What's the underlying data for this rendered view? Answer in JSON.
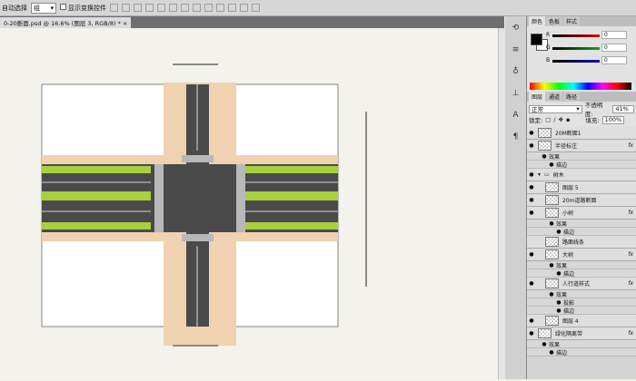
{
  "toolbar": {
    "auto_select_label": "自动选择",
    "auto_select_value": "组",
    "show_transform_label": "显示变换控件"
  },
  "document_tab": {
    "title": "0-20断面.psd @ 16.6% (图层 3, RGB/8) *",
    "close": "×"
  },
  "color_panel": {
    "tabs": [
      "颜色",
      "色板",
      "样式"
    ],
    "channels": [
      {
        "label": "R",
        "value": "0",
        "color": "#d01010"
      },
      {
        "label": "G",
        "value": "0",
        "color": "#20a020"
      },
      {
        "label": "B",
        "value": "0",
        "color": "#1010c0"
      }
    ],
    "foreground": "#000000",
    "background": "#ffffff"
  },
  "layers_panel": {
    "tabs": [
      "图层",
      "通道",
      "路径"
    ],
    "blend_mode": "正常",
    "opacity_label": "不透明度:",
    "opacity": "41%",
    "lock_label": "锁定:",
    "fill_label": "填充:",
    "fill": "100%",
    "items": [
      {
        "type": "layer",
        "name": "20M断面1",
        "fx": false,
        "indent": 0
      },
      {
        "type": "layer",
        "name": "半径标注",
        "fx": true,
        "indent": 0
      },
      {
        "type": "sub",
        "name": "效果",
        "indent": 1
      },
      {
        "type": "sub",
        "name": "描边",
        "indent": 2
      },
      {
        "type": "group",
        "name": "树木",
        "indent": 0
      },
      {
        "type": "layer",
        "name": "图层 5",
        "fx": false,
        "indent": 1
      },
      {
        "type": "layer",
        "name": "20m道路断面",
        "fx": false,
        "indent": 1
      },
      {
        "type": "layer",
        "name": "小树",
        "fx": true,
        "indent": 1
      },
      {
        "type": "sub",
        "name": "效果",
        "indent": 2
      },
      {
        "type": "sub",
        "name": "描边",
        "indent": 3
      },
      {
        "type": "layer",
        "name": "路面线条",
        "fx": false,
        "indent": 1,
        "hidden": true
      },
      {
        "type": "layer",
        "name": "大树",
        "fx": true,
        "indent": 1
      },
      {
        "type": "sub",
        "name": "效果",
        "indent": 2
      },
      {
        "type": "sub",
        "name": "描边",
        "indent": 3
      },
      {
        "type": "layer",
        "name": "人行道样式",
        "fx": true,
        "indent": 1
      },
      {
        "type": "sub",
        "name": "效果",
        "indent": 2
      },
      {
        "type": "sub",
        "name": "投影",
        "indent": 3
      },
      {
        "type": "sub",
        "name": "描边",
        "indent": 3
      },
      {
        "type": "layer",
        "name": "图层 4",
        "fx": false,
        "indent": 1
      },
      {
        "type": "layer",
        "name": "绿化隔离带",
        "fx": true,
        "indent": 0
      },
      {
        "type": "sub",
        "name": "效果",
        "indent": 1
      },
      {
        "type": "sub",
        "name": "描边",
        "indent": 2
      }
    ]
  },
  "colors": {
    "road": "#4a4a4a",
    "sidewalk": "#f0d2b0",
    "green": "#a8d040",
    "crosswalk": "#b8b8b8"
  }
}
